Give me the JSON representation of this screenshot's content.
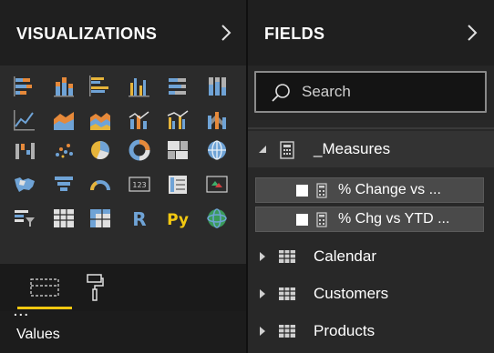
{
  "visualizations": {
    "title": "VISUALIZATIONS",
    "more_label": "...",
    "icons": [
      "stacked-bar-chart-icon",
      "stacked-column-chart-icon",
      "clustered-bar-chart-icon",
      "clustered-column-chart-icon",
      "100-percent-stacked-bar-chart-icon",
      "100-percent-stacked-column-chart-icon",
      "line-chart-icon",
      "area-chart-icon",
      "stacked-area-chart-icon",
      "line-and-stacked-column-chart-icon",
      "line-and-clustered-column-chart-icon",
      "ribbon-chart-icon",
      "waterfall-chart-icon",
      "scatter-chart-icon",
      "pie-chart-icon",
      "donut-chart-icon",
      "treemap-icon",
      "map-icon",
      "filled-map-icon",
      "funnel-icon",
      "gauge-icon",
      "card-icon",
      "multi-row-card-icon",
      "kpi-icon",
      "slicer-icon",
      "table-icon",
      "matrix-icon",
      "r-script-visual-icon",
      "python-visual-icon",
      "arcgis-map-icon"
    ],
    "r_label": "R",
    "py_label": "Py",
    "card_label": "123",
    "tabs": {
      "fields_tab": "fields-tab-icon",
      "format_tab": "format-paint-roller-icon"
    },
    "values_label": "Values"
  },
  "fields": {
    "title": "FIELDS",
    "search": {
      "placeholder": "Search",
      "value": ""
    },
    "tables": [
      {
        "name": "_Measures",
        "expanded": true,
        "icon": "calculator-icon",
        "measures": [
          {
            "label": "% Change vs ...",
            "checked": false,
            "icon": "calculator-icon"
          },
          {
            "label": "% Chg vs YTD ...",
            "checked": false,
            "icon": "calculator-icon"
          }
        ]
      },
      {
        "name": "Calendar",
        "expanded": false,
        "icon": "table-icon"
      },
      {
        "name": "Customers",
        "expanded": false,
        "icon": "table-icon"
      },
      {
        "name": "Products",
        "expanded": false,
        "icon": "table-icon"
      }
    ]
  },
  "colors": {
    "accent": "#f2c811",
    "bar_blue": "#6fa3d6",
    "bar_orange": "#e6893a",
    "bar_gray": "#8c8c8c",
    "pane_dark": "#1c1c1c",
    "fields_bg": "#282828",
    "measure_row": "#4a4a4a"
  }
}
